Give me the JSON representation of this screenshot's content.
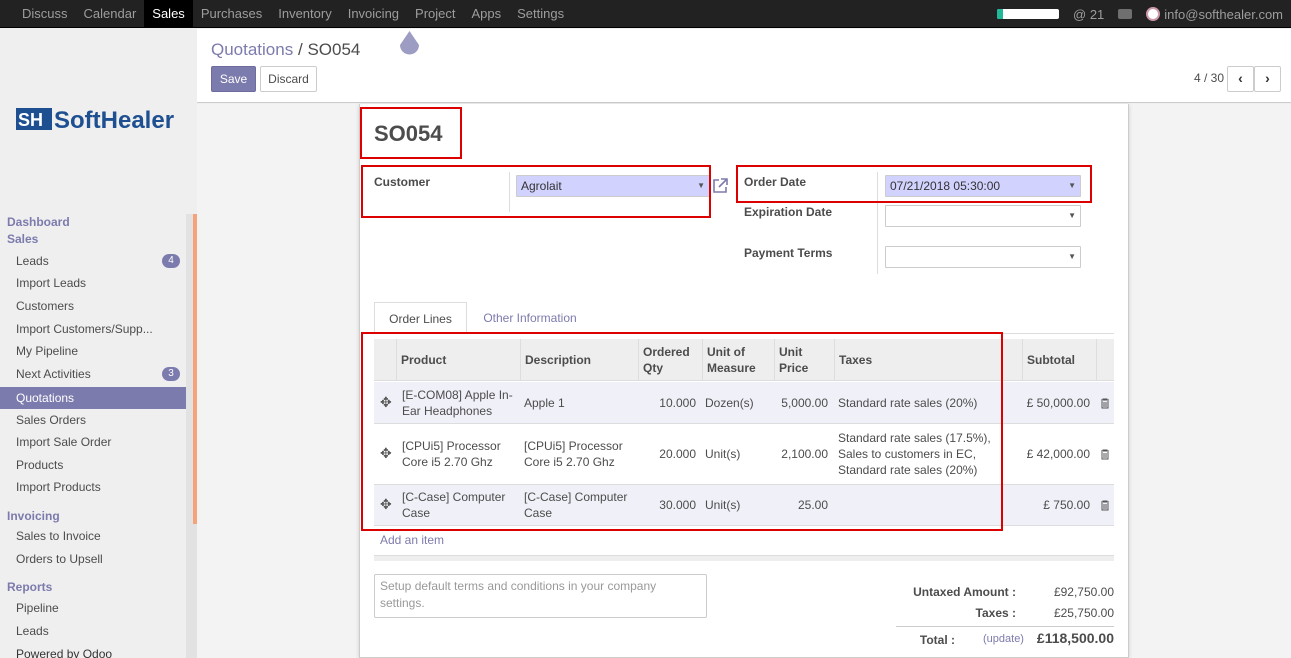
{
  "topbar": {
    "menu": [
      "Discuss",
      "Calendar",
      "Sales",
      "Purchases",
      "Inventory",
      "Invoicing",
      "Project",
      "Apps",
      "Settings"
    ],
    "active_menu": "Sales",
    "mentions": "@ 21",
    "user": "info@softhealer.com",
    "progress": 0.1
  },
  "control": {
    "breadcrumb_parent": "Quotations",
    "breadcrumb_sep": "/",
    "breadcrumb_current": "SO054",
    "save_label": "Save",
    "discard_label": "Discard",
    "pager": "4 / 30",
    "prev": "‹",
    "next": "›"
  },
  "sidebar": {
    "logo_text": "SoftHealer",
    "sections": [
      {
        "title": "Dashboard",
        "items": []
      },
      {
        "title": "Sales",
        "items": [
          {
            "label": "Leads",
            "badge": "4"
          },
          {
            "label": "Import Leads"
          },
          {
            "label": "Customers"
          },
          {
            "label": "Import Customers/Supp..."
          },
          {
            "label": "My Pipeline"
          },
          {
            "label": "Next Activities",
            "badge": "3"
          },
          {
            "label": "Quotations",
            "active": true
          },
          {
            "label": "Sales Orders"
          },
          {
            "label": "Import Sale Order"
          },
          {
            "label": "Products"
          },
          {
            "label": "Import Products"
          }
        ]
      },
      {
        "title": "Invoicing",
        "items": [
          {
            "label": "Sales to Invoice"
          },
          {
            "label": "Orders to Upsell"
          }
        ]
      },
      {
        "title": "Reports",
        "items": [
          {
            "label": "Pipeline"
          },
          {
            "label": "Leads"
          }
        ]
      }
    ],
    "footer": "Powered by Odoo"
  },
  "form": {
    "name": "SO054",
    "customer_label": "Customer",
    "customer_value": "Agrolait",
    "order_date_label": "Order Date",
    "order_date_value": "07/21/2018 05:30:00",
    "expiration_label": "Expiration Date",
    "expiration_value": "",
    "payment_terms_label": "Payment Terms",
    "payment_terms_value": ""
  },
  "tabs": [
    "Order Lines",
    "Other Information"
  ],
  "table": {
    "columns": [
      "Product",
      "Description",
      "Ordered Qty",
      "Unit of Measure",
      "Unit Price",
      "Taxes",
      "Subtotal"
    ],
    "rows": [
      {
        "product": "[E-COM08] Apple In-Ear Headphones",
        "description": "Apple 1",
        "qty": "10.000",
        "uom": "Dozen(s)",
        "price": "5,000.00",
        "taxes": "Standard rate sales (20%)",
        "subtotal": "£ 50,000.00"
      },
      {
        "product": "[CPUi5] Processor Core i5 2.70 Ghz",
        "description": "[CPUi5] Processor Core i5 2.70 Ghz",
        "qty": "20.000",
        "uom": "Unit(s)",
        "price": "2,100.00",
        "taxes": "Standard rate sales (17.5%), Sales to customers in EC, Standard rate sales (20%)",
        "subtotal": "£ 42,000.00"
      },
      {
        "product": "[C-Case] Computer Case",
        "description": "[C-Case] Computer Case",
        "qty": "30.000",
        "uom": "Unit(s)",
        "price": "25.00",
        "taxes": "",
        "subtotal": "£ 750.00"
      }
    ],
    "add_item": "Add an item"
  },
  "note_placeholder": "Setup default terms and conditions in your company settings.",
  "totals": {
    "untaxed_label": "Untaxed Amount :",
    "untaxed_value": "£92,750.00",
    "taxes_label": "Taxes :",
    "taxes_value": "£25,750.00",
    "total_label": "Total :",
    "update_label": "(update)",
    "total_value": "£118,500.00"
  }
}
